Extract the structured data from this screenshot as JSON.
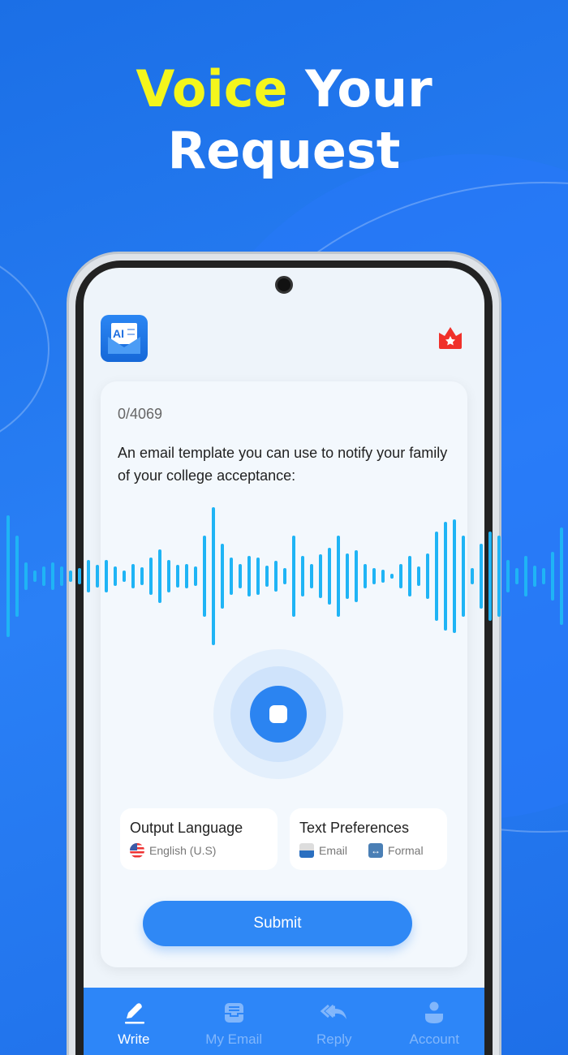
{
  "headline": {
    "highlight": "Voice",
    "rest_line1": " Your",
    "line2": "Request"
  },
  "card": {
    "char_count": "0/4069",
    "prompt": "An email template you can use to notify your family of your college acceptance:"
  },
  "options": {
    "language": {
      "title": "Output Language",
      "value": "English (U.S)",
      "icon": "us-flag-icon"
    },
    "preferences": {
      "title": "Text Preferences",
      "type": "Email",
      "tone": "Formal"
    }
  },
  "submit_label": "Submit",
  "nav": [
    {
      "label": "Write",
      "icon": "pencil-icon",
      "active": true
    },
    {
      "label": "My Email",
      "icon": "inbox-icon"
    },
    {
      "label": "Reply",
      "icon": "reply-all-icon"
    },
    {
      "label": "Account",
      "icon": "user-icon"
    }
  ],
  "colors": {
    "accent": "#2d86f8",
    "highlight": "#f4f61c",
    "wave": "#1fb4f5",
    "crown": "#f0302a"
  }
}
